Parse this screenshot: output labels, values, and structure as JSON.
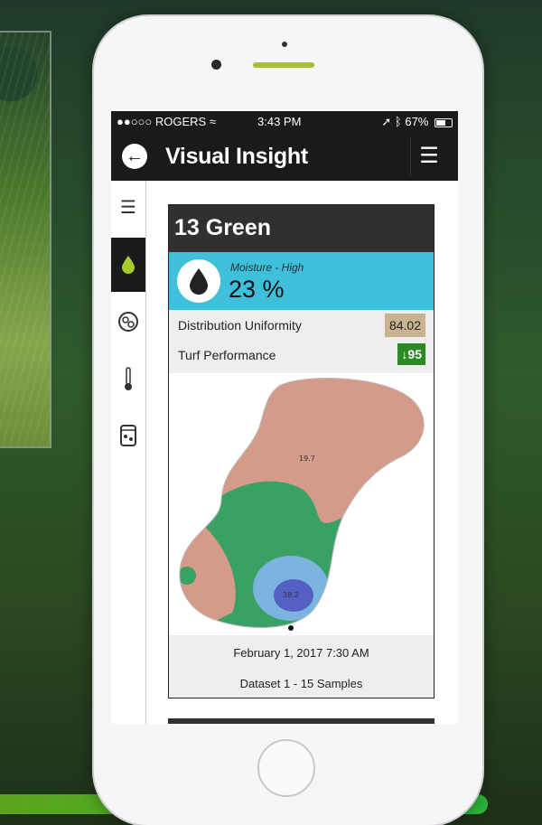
{
  "status_bar": {
    "carrier": "ROGERS",
    "time": "3:43 PM",
    "battery": "67%"
  },
  "app": {
    "title": "Visual Insight",
    "back_icon": "arrow-left-icon",
    "menu_icon": "hamburger-icon"
  },
  "sidebar": {
    "items": [
      {
        "icon": "menu-icon",
        "active": false
      },
      {
        "icon": "moisture-drop-icon",
        "active": true
      },
      {
        "icon": "salinity-icon",
        "active": false
      },
      {
        "icon": "thermometer-icon",
        "active": false
      },
      {
        "icon": "sensor-canister-icon",
        "active": false
      }
    ]
  },
  "card": {
    "title": "13 Green",
    "moisture": {
      "label": "Moisture - High",
      "value": "23 %"
    },
    "metrics": [
      {
        "label": "Distribution Uniformity",
        "value": "84.02"
      },
      {
        "label": "Turf Performance",
        "value": "95",
        "trend": "down"
      }
    ],
    "map": {
      "labels": [
        "19.7",
        "38.2"
      ],
      "colors": {
        "high": "#d49a8a",
        "medium": "#3aa164",
        "low": "#7ab4df",
        "very_low": "#5560c4"
      }
    },
    "timestamp": "February 1, 2017 7:30 AM",
    "dataset": "Dataset 1 - 15 Samples"
  },
  "colors": {
    "accent": "#3fc0da",
    "bar": "#1a1a1a",
    "active_icon": "#a5cc2a"
  }
}
